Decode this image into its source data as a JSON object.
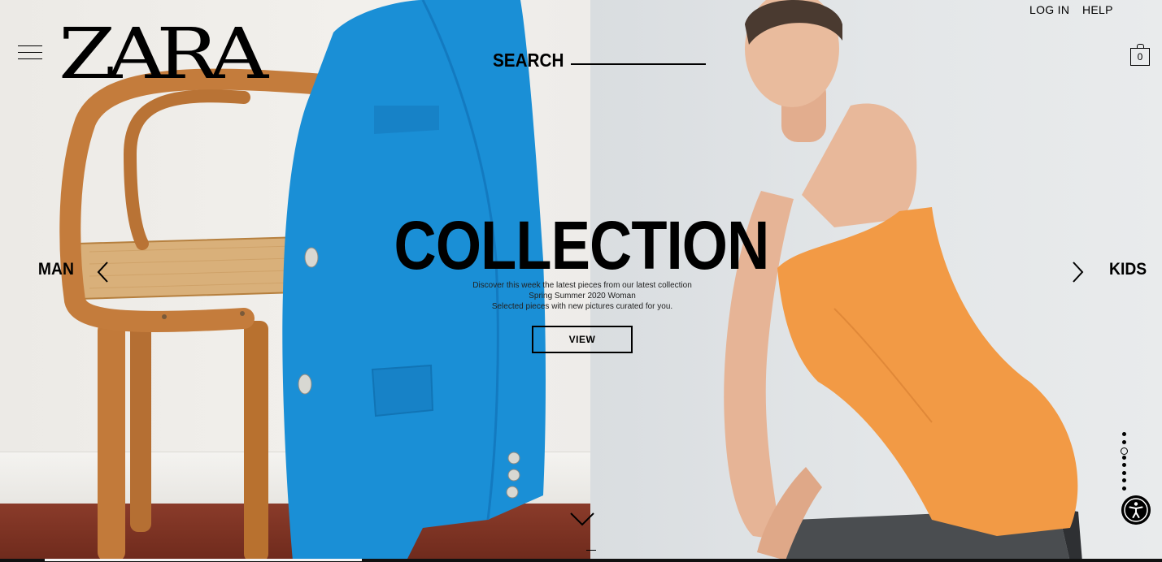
{
  "header": {
    "brand": "ZARA",
    "search_label": "SEARCH",
    "login_label": "LOG IN",
    "help_label": "HELP",
    "bag_count": "0"
  },
  "hero": {
    "title": "COLLECTION",
    "description": [
      "Discover this week the latest pieces from our latest collection",
      "Spring Summer 2020 Woman",
      "Selected pieces with new pictures curated for you."
    ],
    "cta_label": "VIEW"
  },
  "nav": {
    "prev_label": "MAN",
    "next_label": "KIDS"
  },
  "slides": {
    "total": 8,
    "active_index": 2
  },
  "colors": {
    "blazer": "#1a8fd6",
    "dress": "#f29a45",
    "chair": "#c27a3a",
    "floor": "#7a2f20"
  },
  "icons": {
    "menu": "hamburger-icon",
    "bag": "shopping-bag-icon",
    "prev": "chevron-left-icon",
    "next": "chevron-right-icon",
    "scroll": "chevron-down-icon",
    "accessibility": "accessibility-icon"
  }
}
